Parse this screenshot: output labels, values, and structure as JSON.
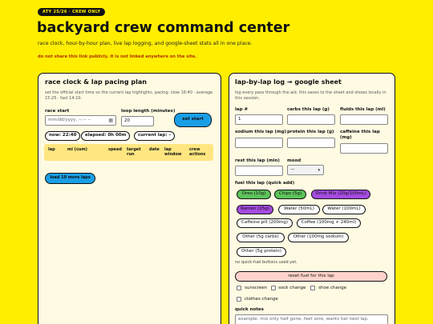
{
  "header": {
    "badge": "ATY 25/26 · CREW ONLY",
    "title": "backyard crew command center",
    "subtitle": "race clock, hour-by-hour plan, live lap logging, and google-sheet stats all in one place.",
    "warning": "do not share this link publicly. it is not linked anywhere on the site."
  },
  "left_panel": {
    "title": "race clock & lap pacing plan",
    "help": "set the official start time so the current lap highlights. pacing: slow 16:40 · average 15:25 · fast 14:10.",
    "race_start_label": "race start",
    "race_start_placeholder": "mm/dd/yyyy, --:-- --",
    "loop_length_label": "loop length (minutes)",
    "loop_length_value": "20",
    "set_start_label": "set start",
    "now_label": "now: 22:40",
    "elapsed_label": "elapsed: 0h 00m",
    "current_lap_label": "current lap: –",
    "table_headers": [
      "lap",
      "mi (cum)",
      "speed",
      "target run",
      "date",
      "lap window",
      "crew actions"
    ],
    "load_more_label": "load 10 more laps"
  },
  "right_panel": {
    "title": "lap-by-lap log → google sheet",
    "help": "log every pass through the aid. this saves to the sheet and shows locally in this session.",
    "fields": {
      "lap": {
        "label": "lap #",
        "value": "1"
      },
      "carbs": {
        "label": "carbs this lap (g)",
        "value": ""
      },
      "fluids": {
        "label": "fluids this lap (ml)",
        "value": ""
      },
      "sodium": {
        "label": "sodium this lap (mg)",
        "value": ""
      },
      "protein": {
        "label": "protein this lap (g)",
        "value": ""
      },
      "caffeine": {
        "label": "caffeine this lap (mg)",
        "value": ""
      },
      "rest": {
        "label": "rest this lap (min)",
        "value": ""
      },
      "mood": {
        "label": "mood",
        "value": "—"
      }
    },
    "fuel_label": "fuel this lap (quick add)",
    "chips": [
      "Oreo (10g)",
      "Chips (5g)",
      "Drink Mix (20g/100mL)",
      "Ramen (25g)",
      "Water (50mL)",
      "Water (100mL)",
      "Caffeine pill (200mg)",
      "Coffee (100mg + 240ml)",
      "Other (5g carbs)",
      "Other (100mg sodium)",
      "Other (5g protein)"
    ],
    "no_fuel_text": "no quick-fuel buttons used yet.",
    "reset_label": "reset fuel for this lap",
    "checkboxes": [
      "sunscreen",
      "sock change",
      "shoe change",
      "clothes change"
    ],
    "notes_label": "quick notes",
    "notes_placeholder": "example: mix only half gone, feet sore, wants hat next lap."
  },
  "colors": {
    "background": "#ffee00",
    "accent_blue": "#1a9fe6",
    "chip_green": "#5dc35a",
    "chip_purple": "#a44be0",
    "warning": "#b03000"
  }
}
